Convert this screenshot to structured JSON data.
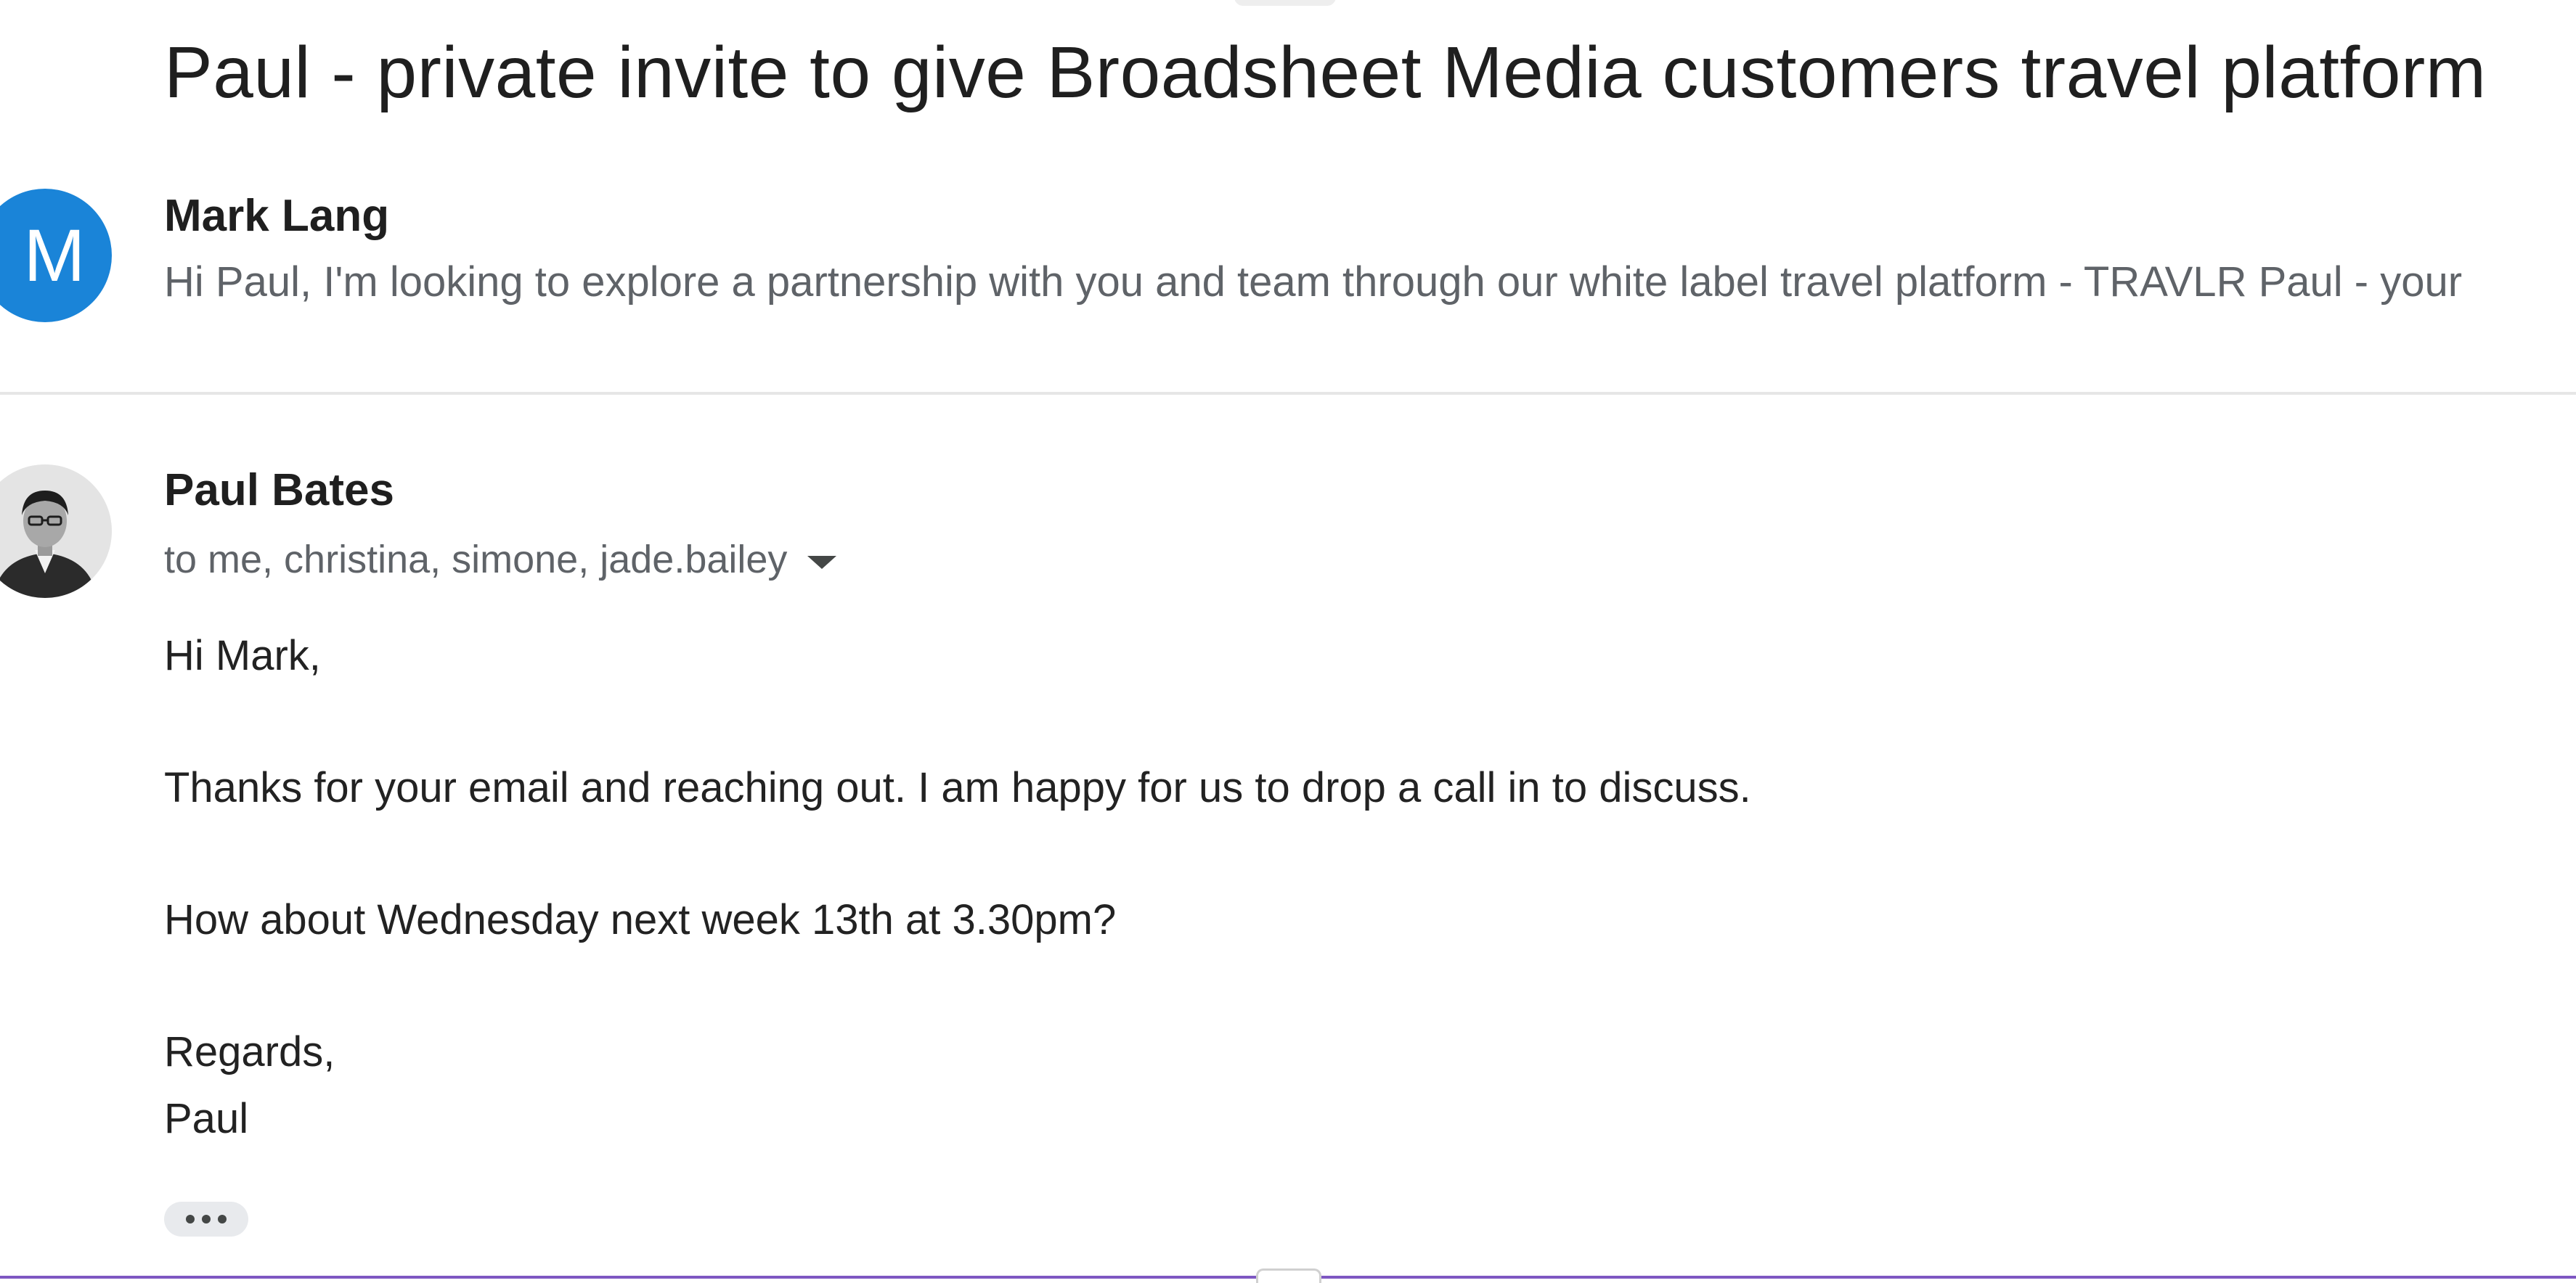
{
  "thread": {
    "subject": "Paul - private invite to give Broadsheet Media customers travel platform"
  },
  "messages": [
    {
      "sender": "Mark Lang",
      "avatar_letter": "M",
      "avatar_color": "#1a84d8",
      "snippet": "Hi Paul, I'm looking to explore a partnership with you and team through our white label travel platform - TRAVLR Paul - your"
    },
    {
      "sender": "Paul Bates",
      "recipients": "to me, christina, simone, jade.bailey",
      "body": [
        "Hi Mark,",
        "Thanks for your email and reaching out. I am happy for us to drop a call in to discuss.",
        "How about Wednesday next week 13th at 3.30pm?",
        "Regards,",
        "Paul"
      ],
      "show_trimmed_icon": "more-horiz-icon"
    }
  ],
  "colors": {
    "accent": "#7e57c2",
    "divider": "#e6e6e6"
  }
}
